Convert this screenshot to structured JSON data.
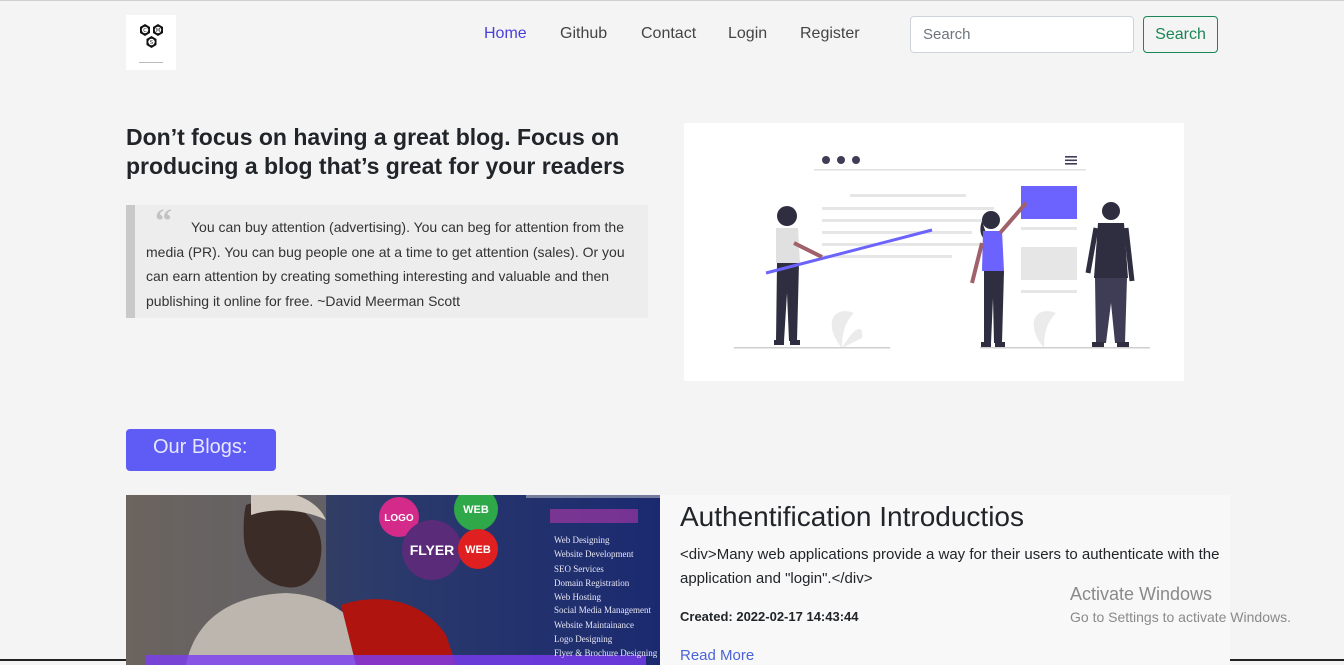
{
  "nav": {
    "logo_letters": [
      "C",
      "M",
      "S"
    ],
    "links": [
      "Home",
      "Github",
      "Contact",
      "Login",
      "Register"
    ],
    "search_placeholder": "Search",
    "search_button": "Search"
  },
  "hero": {
    "title": "Don’t focus on having a great blog. Focus on producing a blog that’s great for your readers",
    "quote_mark": "“",
    "quote": "You can buy attention (advertising). You can beg for attention from the media (PR). You can bug people one at a time to get attention (sales). Or you can earn attention by creating something interesting and valuable and then publishing it online for free. ~David Meerman Scott"
  },
  "blogs": {
    "heading": "Our Blogs:",
    "posts": [
      {
        "title": "Authentification Introductios",
        "description": "<div>Many web applications provide a way for their users to authenticate with the application and \"login\".</div>",
        "created": "Created: 2022-02-17 14:43:44",
        "read_more": "Read More",
        "image_bubbles": [
          "LOGO",
          "FLYER",
          "WEB",
          "WEB"
        ],
        "image_services": [
          "Web Designing",
          "Website Development",
          "SEO Services",
          "Domain Registration",
          "Web Hosting",
          "Social Media Management",
          "Website Maintainance",
          "Logo Designing",
          "Flyer & Brochure Designing"
        ]
      }
    ]
  },
  "os_overlay": {
    "title": "Activate Windows",
    "subtitle": "Go to Settings to activate Windows."
  },
  "colors": {
    "accent_purple": "#5e5cf4",
    "success_green": "#198754",
    "link_blue": "#4a63d6"
  }
}
